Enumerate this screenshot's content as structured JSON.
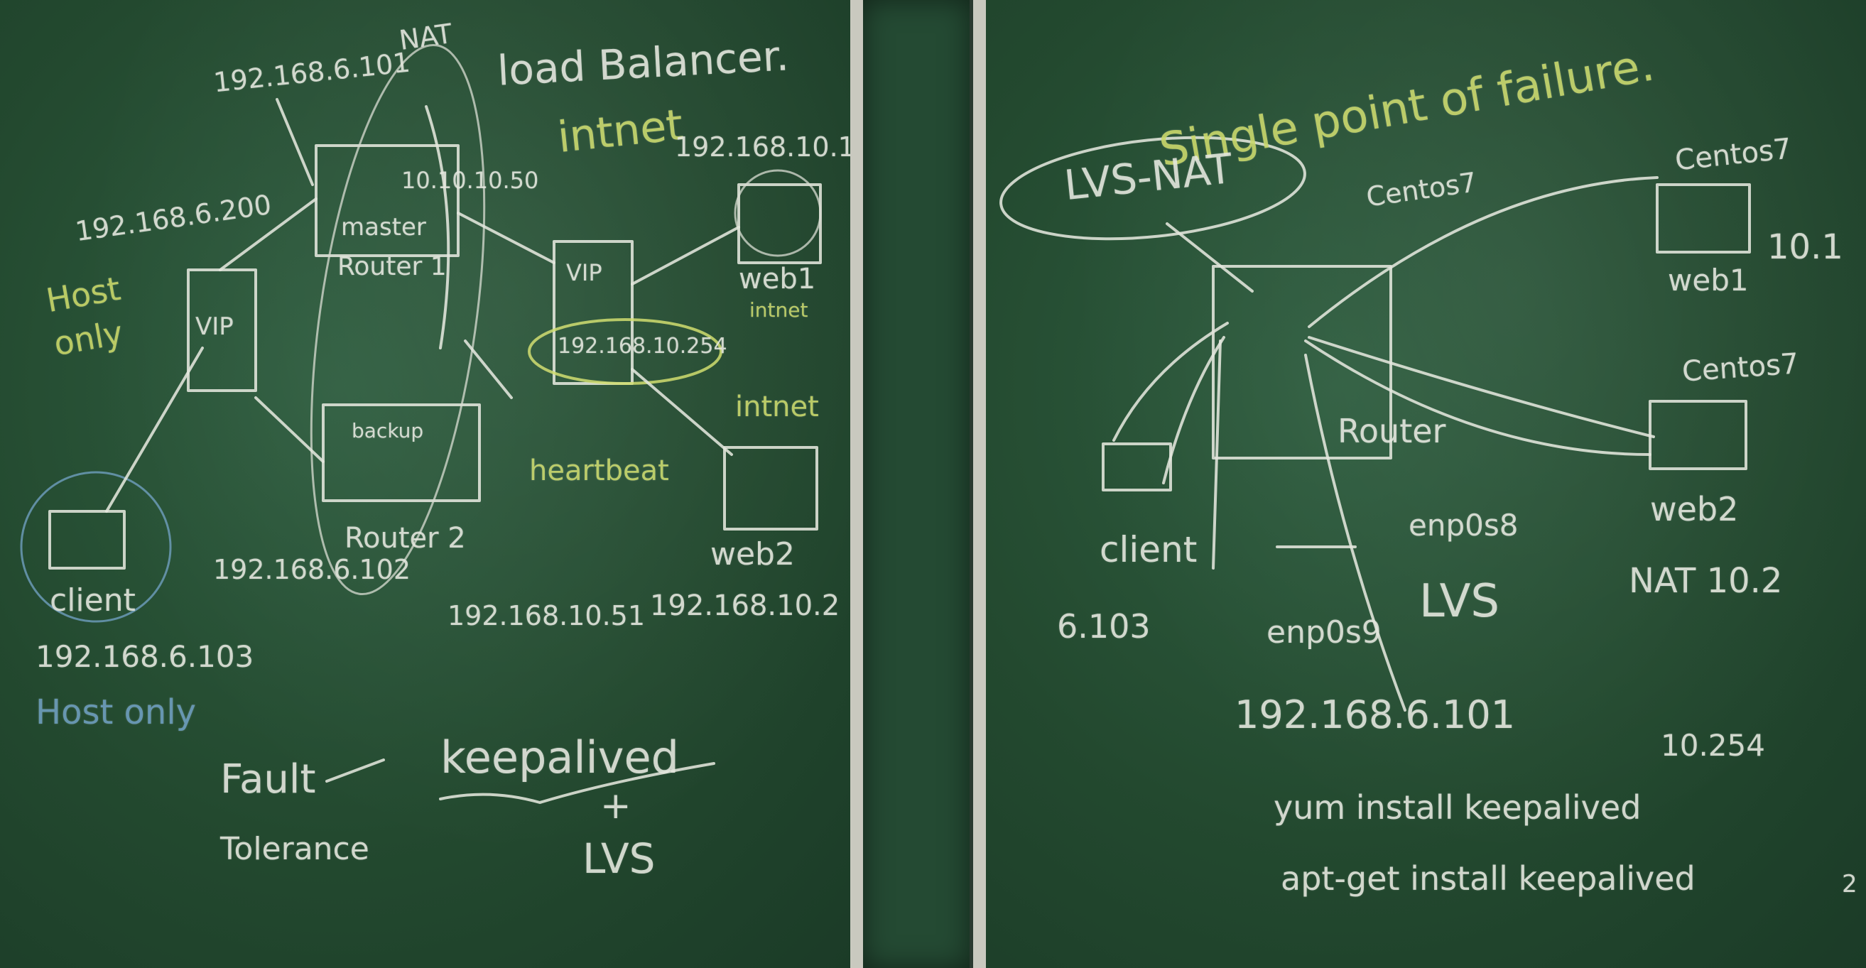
{
  "left_board": {
    "title_ip": "192.168.6.101",
    "title_nat": "NAT",
    "title_lb": "load Balancer.",
    "master_vip": "192.168.6.200",
    "host_only_left": "Host only",
    "vip_left": "VIP",
    "master_label": "master",
    "router1": "Router 1",
    "router1_inner_ip": "10.10.10.50",
    "intnet_top": "intnet",
    "web_net_ip": "192.168.10.1",
    "vip_right": "VIP",
    "vip_right_ip": "192.168.10.254",
    "web1": "web1",
    "web1_net": "intnet",
    "intnet_mid": "intnet",
    "heartbeat": "heartbeat",
    "backup_label": "backup",
    "router2": "Router 2",
    "router2_ip": "192.168.6.102",
    "router2_inner_ip": "192.168.10.51",
    "client": "client",
    "client_ip": "192.168.6.103",
    "host_only_bottom": "Host only",
    "web2": "web2",
    "web2_ip": "192.168.10.2",
    "fault": "Fault",
    "tolerance": "Tolerance",
    "keepalived": "keepalived",
    "plus": "+",
    "lvs": "LVS"
  },
  "right_board": {
    "spof": "Single point of failure.",
    "lvs_nat": "LVS-NAT",
    "centos_router": "Centos7",
    "centos_web1": "Centos7",
    "web1_ip": "10.1",
    "web1": "web1",
    "centos_web2": "Centos7",
    "web2": "web2",
    "nat_ip": "NAT 10.2",
    "router": "Router",
    "client": "client",
    "client_ip": "6.103",
    "enp08": "enp0s8",
    "lvs": "LVS",
    "enp09": "enp0s9",
    "router_ip": "192.168.6.101",
    "vip_ip": "10.254",
    "cmd_yum": "yum install keepalived",
    "cmd_apt": "apt-get install keepalived",
    "footnote": "2"
  }
}
